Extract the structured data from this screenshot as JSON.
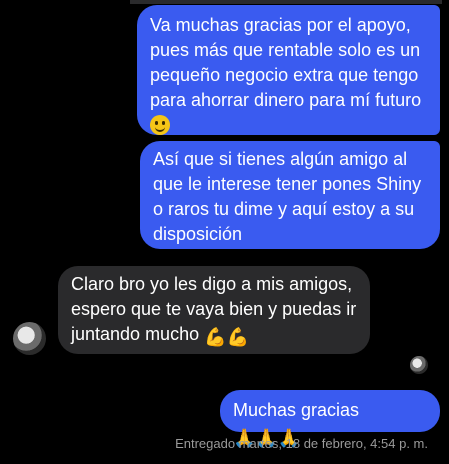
{
  "messages": [
    {
      "direction": "outgoing",
      "text": "Va muchas gracias por el apoyo, pues más que rentable solo es un pequeño negocio extra que tengo para ahorrar dinero para mí futuro",
      "emoji": "smiling-face-icon"
    },
    {
      "direction": "outgoing",
      "text": "Así que si tienes algún amigo al que le interese tener pones Shiny o raros tu dime y aquí estoy a su disposición"
    },
    {
      "direction": "incoming",
      "text": "Claro bro yo les digo a mis amigos, espero que te vaya bien y puedas ir juntando mucho ",
      "emoji_text": "💪💪"
    },
    {
      "direction": "outgoing",
      "text": "Muchas gracias ",
      "emoji_text": "🙏🙏🙏"
    }
  ],
  "status": "Entregado martes, 18 de febrero, 4:54 p. m.",
  "colors": {
    "background": "#000000",
    "outgoing_bubble": "#3a5bf0",
    "incoming_bubble": "#2a2a2c",
    "status_text": "#9a9a9a"
  }
}
